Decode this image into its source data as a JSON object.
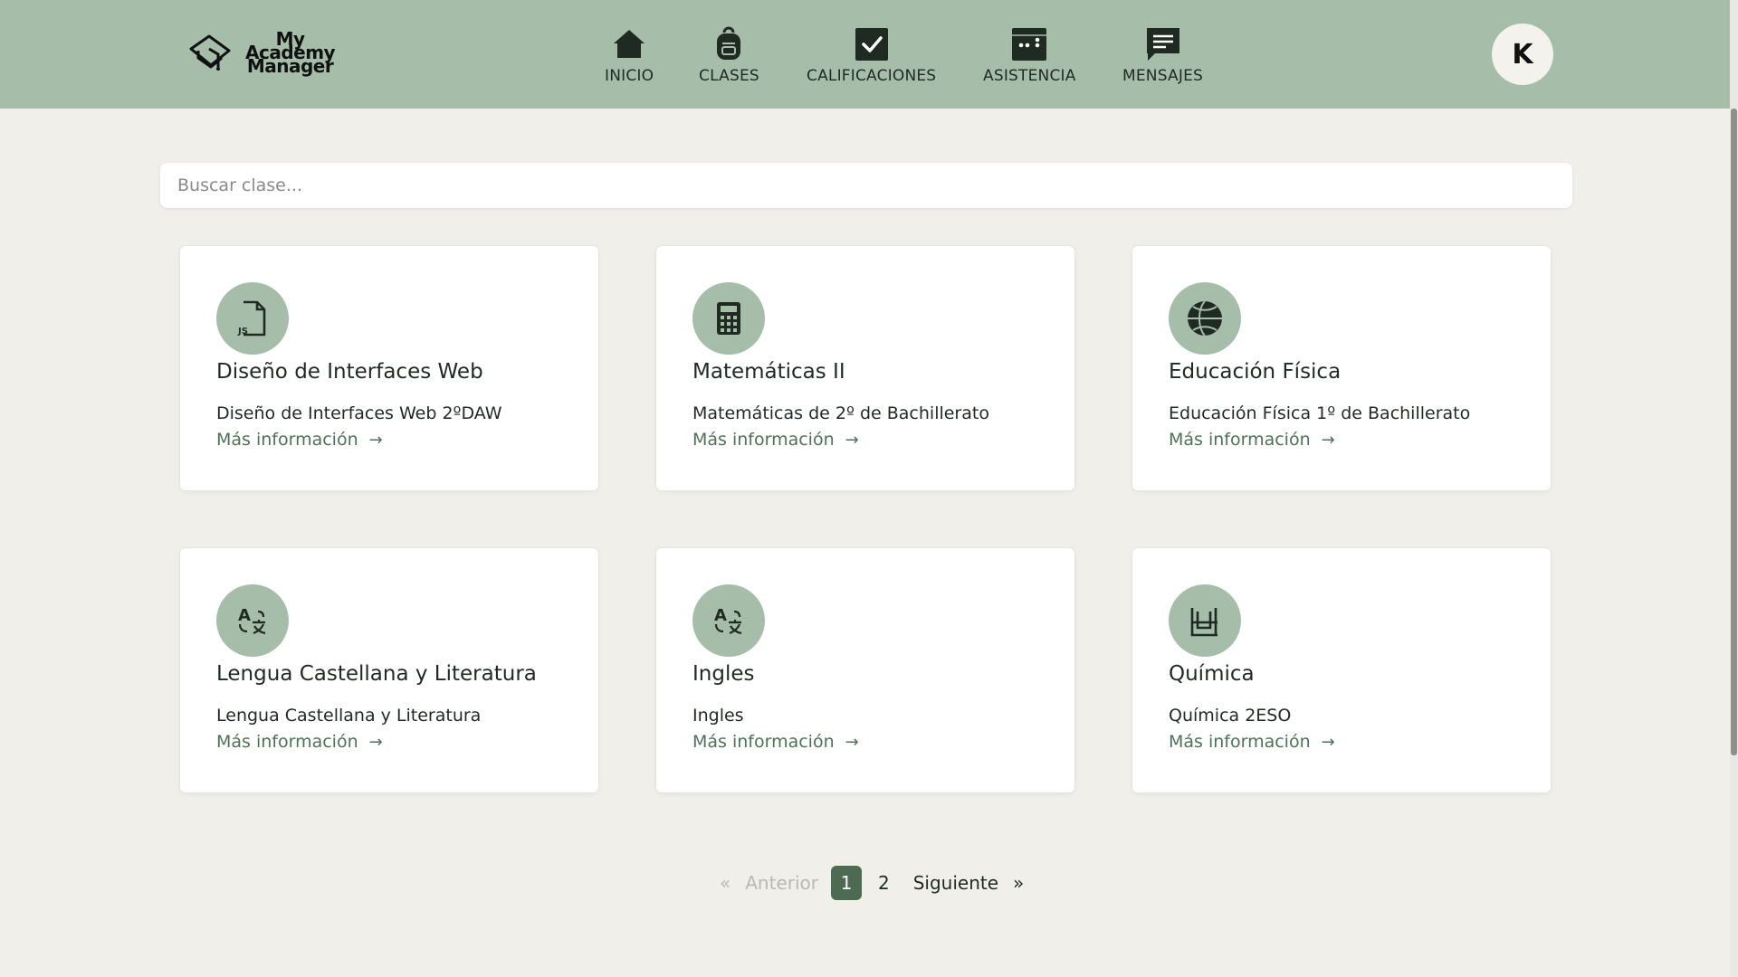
{
  "app": {
    "logo_lines": [
      "My",
      "Academy",
      "Manager"
    ]
  },
  "nav": [
    {
      "label": "INICIO",
      "icon": "home-icon"
    },
    {
      "label": "CLASES",
      "icon": "backpack-icon"
    },
    {
      "label": "CALIFICACIONES",
      "icon": "checkbox-icon"
    },
    {
      "label": "ASISTENCIA",
      "icon": "calendar-icon"
    },
    {
      "label": "MENSAJES",
      "icon": "message-icon"
    }
  ],
  "user": {
    "initial": "K"
  },
  "search": {
    "placeholder": "Buscar clase...",
    "value": ""
  },
  "classes": [
    {
      "title": "Diseño de Interfaces Web",
      "description": "Diseño de Interfaces Web 2ºDAW",
      "link": "Más información",
      "icon": "js-file-icon"
    },
    {
      "title": "Matemáticas II",
      "description": "Matemáticas de 2º de Bachillerato",
      "link": "Más información",
      "icon": "calculator-icon"
    },
    {
      "title": "Educación Física",
      "description": "Educación Física 1º de Bachillerato",
      "link": "Más información",
      "icon": "basketball-icon"
    },
    {
      "title": "Lengua Castellana y Literatura",
      "description": "Lengua Castellana y Literatura",
      "link": "Más información",
      "icon": "translate-icon"
    },
    {
      "title": "Ingles",
      "description": "Ingles",
      "link": "Más información",
      "icon": "translate-icon"
    },
    {
      "title": "Química",
      "description": "Química 2ESO",
      "link": "Más información",
      "icon": "flask-icon"
    }
  ],
  "pagination": {
    "first_symbol": "«",
    "prev_label": "Anterior",
    "pages": [
      "1",
      "2"
    ],
    "current_page": "1",
    "next_label": "Siguiente",
    "last_symbol": "»"
  },
  "colors": {
    "header": "#a6bda9",
    "background": "#f1efe9",
    "accent": "#4d6b52",
    "link": "#4d7356"
  }
}
